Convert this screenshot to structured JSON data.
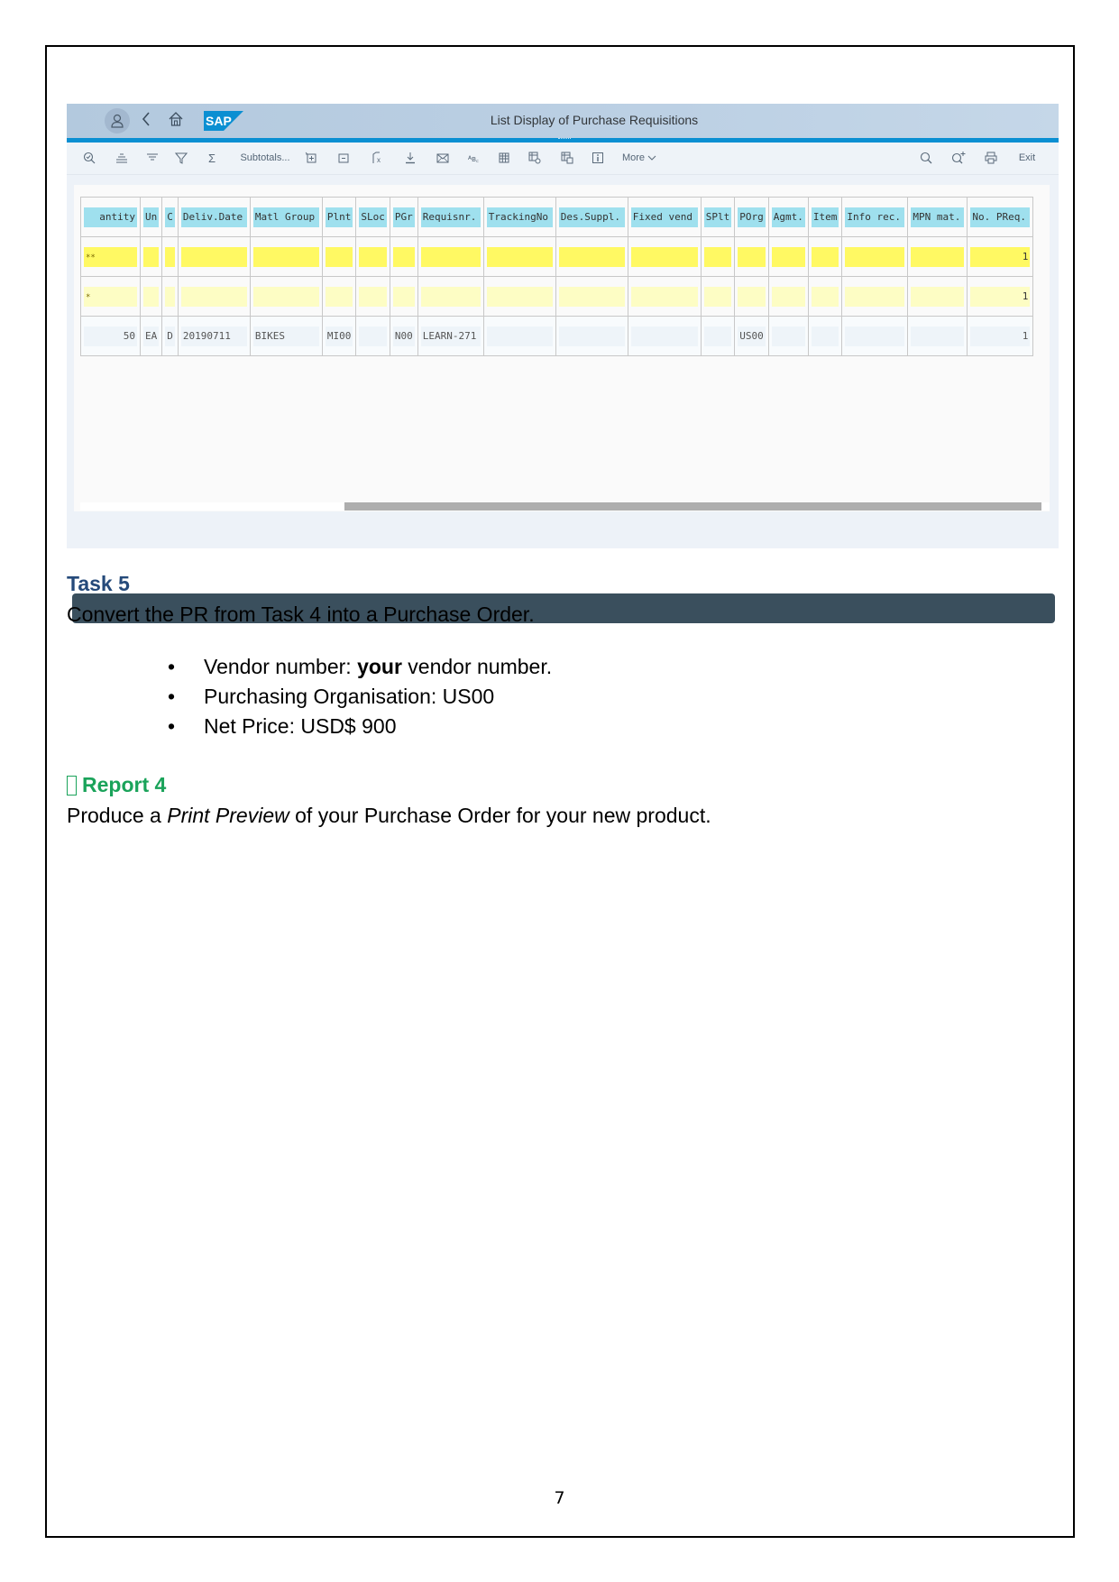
{
  "sap": {
    "title": "List Display of Purchase Requisitions",
    "header_icons": [
      "user-icon",
      "back-icon",
      "home-icon",
      "sap-logo"
    ],
    "logo_text": "SAP",
    "toolbar": {
      "subtotals_label": "Subtotals...",
      "more_label": "More",
      "exit_label": "Exit"
    },
    "table": {
      "columns": [
        "antity",
        "Un",
        "C",
        "Deliv.Date",
        "Matl Group",
        "Plnt",
        "SLoc",
        "PGr",
        "Requisnr.",
        "TrackingNo",
        "Des.Suppl.",
        "Fixed vend",
        "SPlt",
        "POrg",
        "Agmt.",
        "Item",
        "Info rec.",
        "MPN mat.",
        "No. PReq."
      ],
      "rows": [
        {
          "type": "total",
          "marker": "**",
          "cells": [
            "",
            "",
            "",
            "",
            "",
            "",
            "",
            "",
            "",
            "",
            "",
            "",
            "",
            "",
            "",
            "",
            "",
            "",
            "1"
          ]
        },
        {
          "type": "subtotal",
          "marker": "*",
          "cells": [
            "",
            "",
            "",
            "",
            "",
            "",
            "",
            "",
            "",
            "",
            "",
            "",
            "",
            "",
            "",
            "",
            "",
            "",
            "1"
          ]
        },
        {
          "type": "data",
          "marker": "",
          "cells": [
            "50",
            "EA",
            "D",
            "20190711",
            "BIKES",
            "MI00",
            "",
            "N00",
            "LEARN-271",
            "",
            "",
            "",
            "",
            "US00",
            "",
            "",
            "",
            "",
            "1"
          ]
        }
      ]
    },
    "colors": {
      "header_bg": "#b8cde1",
      "accent_line": "#0a8fd2",
      "column_header": "#9fe0ee",
      "total_row": "#fff963",
      "subtotal_row": "#fdfdc4",
      "footer_bar": "#3a4f5d"
    }
  },
  "document": {
    "task_title": "Task 5",
    "task_text": "Convert the PR from Task 4 into a Purchase Order.",
    "bullets": [
      {
        "prefix": "Vendor number: ",
        "bold": "your",
        "suffix": " vendor number."
      },
      {
        "prefix": "Purchasing Organisation: US00",
        "bold": "",
        "suffix": ""
      },
      {
        "prefix": "Net Price: USD$ 900",
        "bold": "",
        "suffix": ""
      }
    ],
    "bullet_char": "•",
    "report_title": "Report 4",
    "report_text_prefix": "Produce a ",
    "report_text_italic": "Print Preview",
    "report_text_suffix": " of your Purchase Order for your new product.",
    "page_number": "7",
    "colors": {
      "task_title": "#254a7a",
      "report_title": "#1aa35a"
    }
  }
}
